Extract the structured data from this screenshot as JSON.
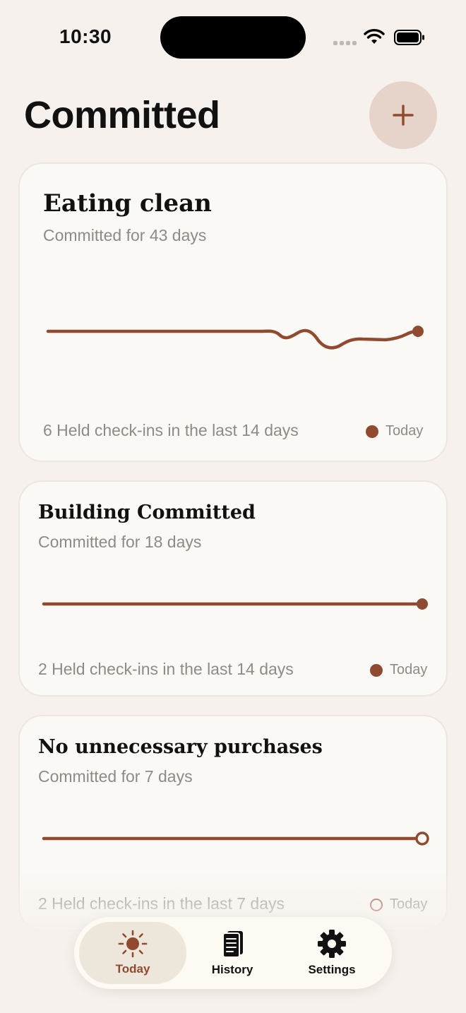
{
  "status_bar": {
    "time": "10:30"
  },
  "header": {
    "title": "Committed",
    "add_icon": "plus-icon"
  },
  "colors": {
    "accent": "#8f4a30",
    "background": "#f6f1ec",
    "card": "#fbf9f6",
    "muted_text": "#8f8a85",
    "add_button_bg": "#e6d4cb"
  },
  "commitments": [
    {
      "title": "Eating clean",
      "subtitle": "Committed for 43 days",
      "footer": "6 Held check-ins in the last 14 days",
      "today_label": "Today",
      "today_held": true
    },
    {
      "title": "Building Committed",
      "subtitle": "Committed for 18 days",
      "footer": "2 Held check-ins in the last 14 days",
      "today_label": "Today",
      "today_held": true
    },
    {
      "title": "No unnecessary purchases",
      "subtitle": "Committed for 7 days",
      "footer": "2 Held check-ins in the last 7 days",
      "today_label": "Today",
      "today_held": false
    }
  ],
  "tabs": [
    {
      "label": "Today",
      "icon": "sun-icon",
      "active": true
    },
    {
      "label": "History",
      "icon": "journal-icon",
      "active": false
    },
    {
      "label": "Settings",
      "icon": "gear-icon",
      "active": false
    }
  ]
}
